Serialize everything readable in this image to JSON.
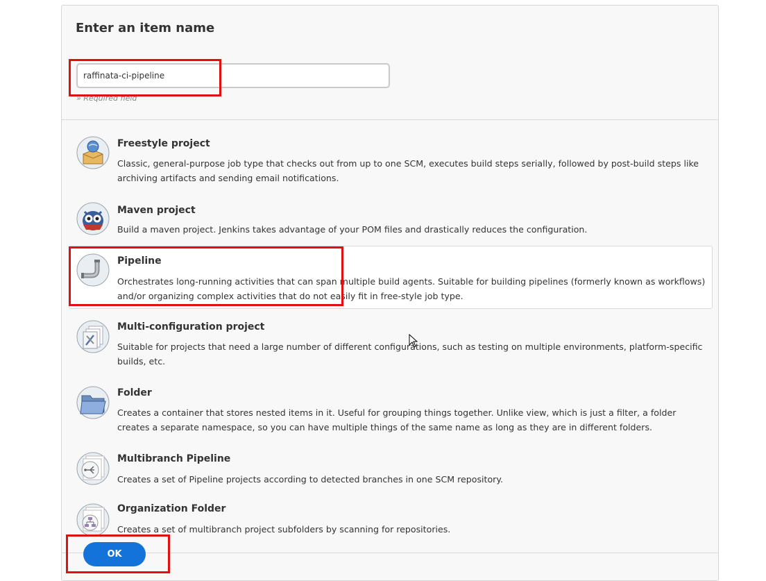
{
  "header": {
    "title": "Enter an item name",
    "input_value": "raffinata-ci-pipeline",
    "required_note": "» Required field"
  },
  "items": [
    {
      "name": "Freestyle project",
      "icon": "freestyle-icon",
      "desc": "Classic, general-purpose job type that checks out from up to one SCM, executes build steps serially, followed by post-build steps like archiving artifacts and sending email notifications."
    },
    {
      "name": "Maven project",
      "icon": "maven-owl-icon",
      "desc": "Build a maven project. Jenkins takes advantage of your POM files and drastically reduces the configuration."
    },
    {
      "name": "Pipeline",
      "icon": "pipe-icon",
      "desc": "Orchestrates long-running activities that can span multiple build agents. Suitable for building pipelines (formerly known as workflows) and/or organizing complex activities that do not easily fit in free-style job type."
    },
    {
      "name": "Multi-configuration project",
      "icon": "multi-config-icon",
      "desc": "Suitable for projects that need a large number of different configurations, such as testing on multiple environments, platform-specific builds, etc."
    },
    {
      "name": "Folder",
      "icon": "folder-icon",
      "desc": "Creates a container that stores nested items in it. Useful for grouping things together. Unlike view, which is just a filter, a folder creates a separate namespace, so you can have multiple things of the same name as long as they are in different folders."
    },
    {
      "name": "Multibranch Pipeline",
      "icon": "multibranch-icon",
      "desc": "Creates a set of Pipeline projects according to detected branches in one SCM repository."
    },
    {
      "name": "Organization Folder",
      "icon": "organization-folder-icon",
      "desc": "Creates a set of multibranch project subfolders by scanning for repositories."
    }
  ],
  "ok_label": "OK",
  "colors": {
    "highlight": "#e01010",
    "button": "#1373d9"
  }
}
